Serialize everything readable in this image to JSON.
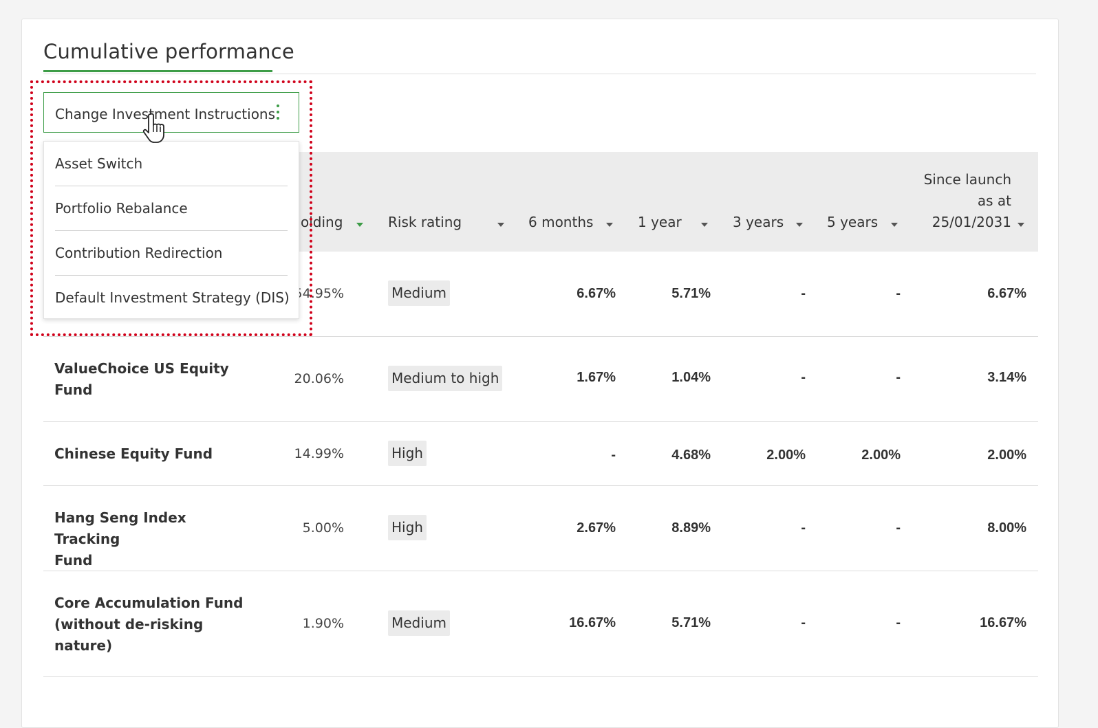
{
  "section": {
    "title": "Cumulative performance"
  },
  "change_instructions": {
    "label": "Change Investment Instructions",
    "menu": [
      "Asset Switch",
      "Portfolio Rebalance",
      "Contribution Redirection",
      "Default Investment Strategy (DIS)"
    ]
  },
  "table": {
    "headers": {
      "holding": "olding",
      "risk": "Risk rating",
      "m6": "6 months",
      "y1": "1 year",
      "y3": "3 years",
      "y5": "5 years",
      "since_line1": "Since launch",
      "since_line2": "as at",
      "since_line3": "25/01/2031"
    },
    "rows": [
      {
        "fund_line1": "",
        "fund_line2": "",
        "fund_line3": "",
        "holding": "54.95%",
        "risk": "Medium",
        "m6": "6.67%",
        "y1": "5.71%",
        "y3": "-",
        "y5": "-",
        "since": "6.67%"
      },
      {
        "fund_line1": "ValueChoice US Equity",
        "fund_line2": "Fund",
        "fund_line3": "",
        "holding": "20.06%",
        "risk": "Medium to high",
        "m6": "1.67%",
        "y1": "1.04%",
        "y3": "-",
        "y5": "-",
        "since": "3.14%"
      },
      {
        "fund_line1": "Chinese Equity Fund",
        "fund_line2": "",
        "fund_line3": "",
        "holding": "14.99%",
        "risk": "High",
        "m6": "-",
        "y1": "4.68%",
        "y3": "2.00%",
        "y5": "2.00%",
        "since": "2.00%"
      },
      {
        "fund_line1": "Hang Seng Index Tracking",
        "fund_line2": "Fund",
        "fund_line3": "",
        "holding": "5.00%",
        "risk": "High",
        "m6": "2.67%",
        "y1": "8.89%",
        "y3": "-",
        "y5": "-",
        "since": "8.00%"
      },
      {
        "fund_line1": "Core Accumulation Fund",
        "fund_line2": "(without de-risking",
        "fund_line3": "nature)",
        "holding": "1.90%",
        "risk": "Medium",
        "m6": "16.67%",
        "y1": "5.71%",
        "y3": "-",
        "y5": "-",
        "since": "16.67%"
      }
    ]
  },
  "colors": {
    "accent": "#3d9c47",
    "highlight": "#d0021b",
    "header_bg": "#ececec"
  },
  "icons": {
    "menu": "kebab-icon",
    "sort": "sort-caret-icon",
    "cursor": "hand-pointer-icon"
  }
}
